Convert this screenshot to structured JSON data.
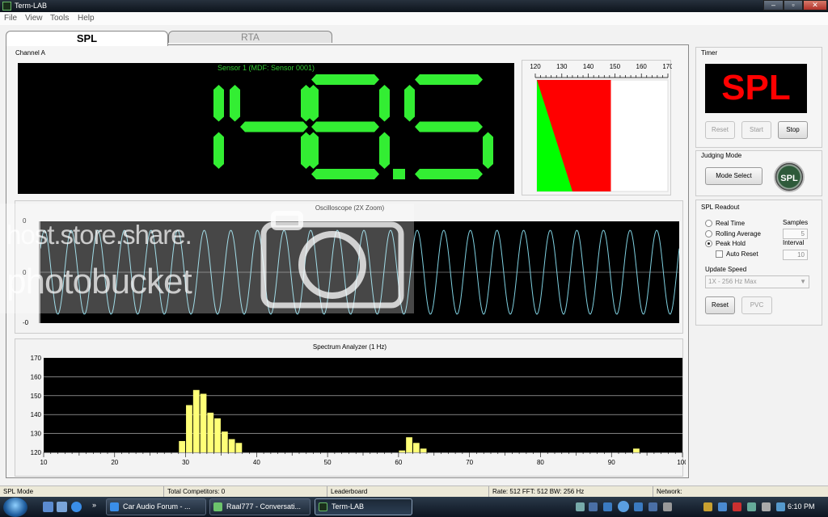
{
  "window": {
    "title": "Term-LAB"
  },
  "menu": [
    "File",
    "View",
    "Tools",
    "Help"
  ],
  "tabs": {
    "spl": "SPL",
    "rta": "RTA"
  },
  "channel_label": "Channel A",
  "display": {
    "sensor": "Sensor 1 (MDF: Sensor 0001)",
    "reading": "148.5",
    "accent_color": "#33ee33"
  },
  "meter": {
    "ticks": [
      "120",
      "130",
      "140",
      "150",
      "160",
      "170"
    ],
    "min": 120,
    "max": 170,
    "value": 148.5
  },
  "oscilloscope": {
    "title": "Oscilloscope (2X Zoom)",
    "y_ticks": [
      "0",
      "0",
      "-0"
    ]
  },
  "spectrum": {
    "title": "Spectrum Analyzer (1 Hz)",
    "x_ticks": [
      "10",
      "20",
      "30",
      "40",
      "50",
      "60",
      "70",
      "80",
      "90",
      "100"
    ],
    "y_ticks": [
      "170",
      "160",
      "150",
      "140",
      "130",
      "120"
    ]
  },
  "chart_data": {
    "type": "bar",
    "title": "Spectrum Analyzer (1 Hz)",
    "xlabel": "",
    "ylabel": "",
    "xlim": [
      10,
      100
    ],
    "ylim": [
      120,
      170
    ],
    "x": [
      29.5,
      30.5,
      31.5,
      32.5,
      33.5,
      34.5,
      35.5,
      36.5,
      37.5,
      60.5,
      61.5,
      62.5,
      63.5,
      93.5
    ],
    "values": [
      126,
      145,
      153,
      151,
      141,
      138,
      131,
      127,
      125,
      121,
      128,
      125,
      122,
      122
    ],
    "bar_color": "#ffff77",
    "grid": true
  },
  "timer": {
    "label": "Timer",
    "display": "SPL",
    "reset": "Reset",
    "start": "Start",
    "stop": "Stop"
  },
  "judging": {
    "label": "Judging Mode",
    "mode_select": "Mode Select",
    "logo_text": "SPL"
  },
  "readout": {
    "label": "SPL Readout",
    "real_time": "Real Time",
    "rolling_average": "Rolling Average",
    "peak_hold": "Peak Hold",
    "auto_reset": "Auto Reset",
    "samples_label": "Samples",
    "samples_value": "5",
    "interval_label": "Interval",
    "interval_value": "10",
    "update_speed_label": "Update Speed",
    "update_speed_value": "1X - 256 Hz Max",
    "reset": "Reset",
    "pvc": "PVC"
  },
  "status": {
    "mode": "SPL Mode",
    "competitors": "Total Competitors: 0",
    "leaderboard": "Leaderboard",
    "rate": "Rate: 512 FFT: 512 BW: 256 Hz",
    "network": "Network:"
  },
  "taskbar": {
    "tasks": [
      "Car Audio Forum - ...",
      "Raal777 - Conversati...",
      "Term-LAB"
    ],
    "clock": "6:10 PM"
  },
  "watermark": {
    "line1": "host.store.share.",
    "line2": "photobucket"
  }
}
